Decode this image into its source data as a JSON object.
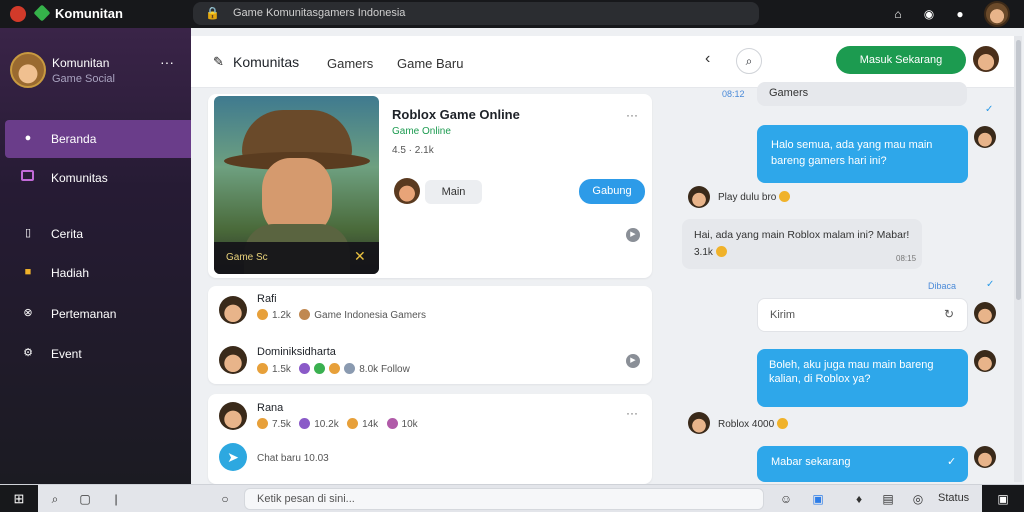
{
  "app": {
    "title": "Komunitan"
  },
  "top_search": {
    "text": "Game Komunitasgamers Indonesia"
  },
  "sidebar": {
    "user_name": "Komunitan",
    "user_sub": "Game Social",
    "items": [
      {
        "label": "Beranda",
        "icon": "home-icon"
      },
      {
        "label": "Komunitas",
        "icon": "message-icon"
      },
      {
        "label": "Cerita",
        "icon": "document-icon"
      },
      {
        "label": "Hadiah",
        "icon": "gift-icon"
      },
      {
        "label": "Pertemanan",
        "icon": "friends-icon"
      },
      {
        "label": "Event",
        "icon": "settings-icon"
      }
    ]
  },
  "header": {
    "title": "Komunitas",
    "tabs": [
      "Gamers",
      "Game Baru"
    ],
    "cta": "Masuk Sekarang"
  },
  "game_card": {
    "title": "Roblox Game Online",
    "subtitle": "Game Online",
    "meta": "4.5 · 2.1k",
    "art_label": "Game Sc",
    "chip": "Main",
    "join_button": "Gabung"
  },
  "rows": [
    {
      "name": "Rafi",
      "v1": "1.2k",
      "v2": "Game Indonesia Gamers"
    },
    {
      "name": "Dominiksidharta",
      "v1": "1.5k",
      "v2": "8.0k",
      "v3": "Follow"
    },
    {
      "name": "Rana",
      "v1": "7.5k",
      "v2": "10.2k",
      "v3": "14k",
      "v4": "10k"
    }
  ],
  "new_chat": "Chat baru 10.03",
  "chat": {
    "m1_time": "08:12",
    "m1_text": "Gamers",
    "m2_text": "Halo semua, ada yang mau main bareng gamers hari ini?",
    "m3_text": "Play dulu bro",
    "m4_text": "Hai, ada yang main Roblox malam ini? Mabar!",
    "m4_meta": "3.1k",
    "m4_time": "08:15",
    "seen_text": "Dibaca",
    "input_bubble": "Kirim",
    "m5_text": "Boleh, aku juga mau main bareng kalian, di Roblox ya?",
    "m6_text": "Roblox 4000",
    "m7_text": "Mabar sekarang"
  },
  "composer": {
    "placeholder": "Ketik pesan di sini..."
  },
  "status": {
    "label": "Status"
  },
  "colors": {
    "accent_green": "#1c9b50",
    "accent_blue": "#2ea7ea",
    "sidebar_active": "#6a3d8a"
  }
}
